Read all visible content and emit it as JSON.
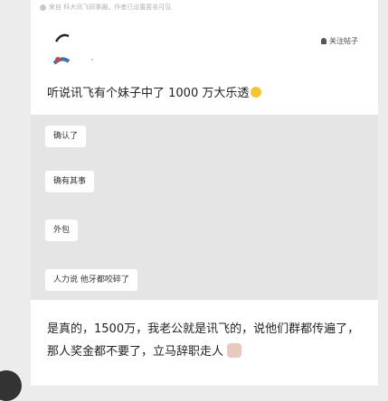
{
  "post": {
    "source_text": "来自 科大讯飞同事圈，作者已设置匿名可见",
    "follow_label": "关注帖子",
    "title": "听说讯飞有个妹子中了 1000 万大乐透"
  },
  "comments": [
    {
      "text": "确认了"
    },
    {
      "text": "确有其事"
    },
    {
      "text": "外包"
    },
    {
      "text": "人力说 他牙都咬碎了"
    }
  ],
  "reply": {
    "text": "是真的，1500万，我老公就是讯飞的，说他们群都传遍了，那人奖金都不要了，立马辞职走人"
  }
}
